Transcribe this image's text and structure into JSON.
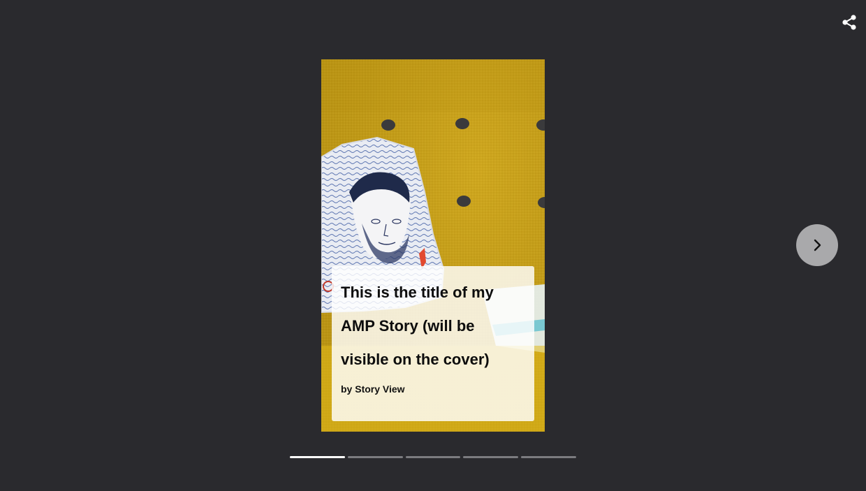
{
  "story": {
    "title": "This is the title of my AMP Story (will be visible on the cover)",
    "byline": "by Story View"
  },
  "controls": {
    "share_icon": "share-icon",
    "next_icon": "chevron-right-icon"
  },
  "progress": {
    "segments": 5,
    "active_index": 0
  },
  "colors": {
    "background": "#2a2a2e",
    "mustard": "#c9a11a",
    "next_button": "#a9a9ab"
  }
}
